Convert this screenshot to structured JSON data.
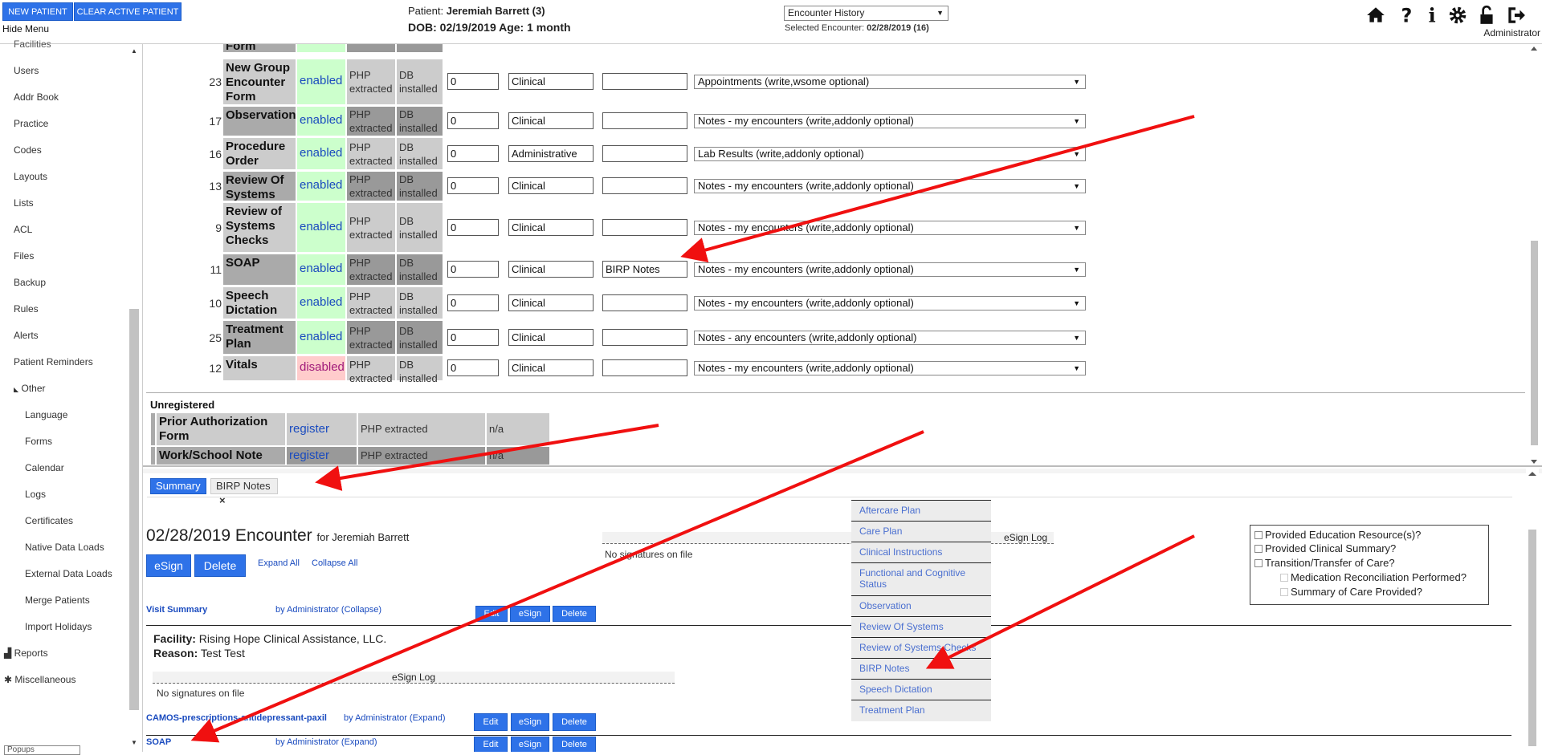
{
  "topbar": {
    "new_patient": "NEW PATIENT",
    "clear_patient": "CLEAR ACTIVE PATIENT",
    "hide_menu": "Hide Menu",
    "patient_label": "Patient:",
    "patient_name": "Jeremiah Barrett (3)",
    "dob_line": "DOB: 02/19/2019 Age: 1 month",
    "encounter_select": "Encounter History",
    "selected_label": "Selected Encounter:",
    "selected_value": "02/28/2019 (16)",
    "user": "Administrator"
  },
  "sidebar": {
    "top_partial": "Facilities",
    "items": [
      "Users",
      "Addr Book",
      "Practice",
      "Codes",
      "Layouts",
      "Lists",
      "ACL",
      "Files",
      "Backup",
      "Rules",
      "Alerts",
      "Patient Reminders"
    ],
    "other": "Other",
    "other_items": [
      "Language",
      "Forms",
      "Calendar",
      "Logs",
      "Certificates",
      "Native Data Loads",
      "External Data Loads",
      "Merge Patients",
      "Import Holidays"
    ],
    "reports": "Reports",
    "misc": "Miscellaneous",
    "bottom_select": "Popups"
  },
  "forms": {
    "partial_name": "Form",
    "rows": [
      {
        "id": "23",
        "name": [
          "New Group",
          "Encounter",
          "Form"
        ],
        "status": "enabled",
        "php": "PHP",
        "php2": "extracted",
        "db": "DB",
        "db2": "installed",
        "priority": "0",
        "category": "Clinical",
        "nickname": "",
        "acl": "Appointments (write,wsome optional)"
      },
      {
        "id": "17",
        "name": [
          "Observation"
        ],
        "status": "enabled",
        "php": "PHP",
        "php2": "extracted",
        "db": "DB",
        "db2": "installed",
        "priority": "0",
        "category": "Clinical",
        "nickname": "",
        "acl": "Notes - my encounters (write,addonly optional)"
      },
      {
        "id": "16",
        "name": [
          "Procedure",
          "Order"
        ],
        "status": "enabled",
        "php": "PHP",
        "php2": "extracted",
        "db": "DB",
        "db2": "installed",
        "priority": "0",
        "category": "Administrative",
        "nickname": "",
        "acl": "Lab Results (write,addonly optional)"
      },
      {
        "id": "13",
        "name": [
          "Review Of",
          "Systems"
        ],
        "status": "enabled",
        "php": "PHP",
        "php2": "extracted",
        "db": "DB",
        "db2": "installed",
        "priority": "0",
        "category": "Clinical",
        "nickname": "",
        "acl": "Notes - my encounters (write,addonly optional)"
      },
      {
        "id": "9",
        "name": [
          "Review of",
          "Systems",
          "Checks"
        ],
        "status": "enabled",
        "php": "PHP",
        "php2": "extracted",
        "db": "DB",
        "db2": "installed",
        "priority": "0",
        "category": "Clinical",
        "nickname": "",
        "acl": "Notes - my encounters (write,addonly optional)"
      },
      {
        "id": "11",
        "name": [
          "SOAP"
        ],
        "status": "enabled",
        "php": "PHP",
        "php2": "extracted",
        "db": "DB",
        "db2": "installed",
        "priority": "0",
        "category": "Clinical",
        "nickname": "BIRP Notes",
        "acl": "Notes - my encounters (write,addonly optional)"
      },
      {
        "id": "10",
        "name": [
          "Speech",
          "Dictation"
        ],
        "status": "enabled",
        "php": "PHP",
        "php2": "extracted",
        "db": "DB",
        "db2": "installed",
        "priority": "0",
        "category": "Clinical",
        "nickname": "",
        "acl": "Notes - my encounters (write,addonly optional)"
      },
      {
        "id": "25",
        "name": [
          "Treatment",
          "Plan"
        ],
        "status": "enabled",
        "php": "PHP",
        "php2": "extracted",
        "db": "DB",
        "db2": "installed",
        "priority": "0",
        "category": "Clinical",
        "nickname": "",
        "acl": "Notes - any encounters (write,addonly optional)"
      },
      {
        "id": "12",
        "name": [
          "Vitals"
        ],
        "status": "disabled",
        "php": "PHP",
        "php2": "extracted",
        "db": "DB",
        "db2": "installed",
        "priority": "0",
        "category": "Clinical",
        "nickname": "",
        "acl": "Notes - my encounters (write,addonly optional)"
      }
    ],
    "unregistered_title": "Unregistered",
    "unregistered": [
      {
        "name": [
          "Prior Authorization",
          "Form"
        ],
        "action": "register",
        "php": "PHP extracted",
        "na": "n/a"
      },
      {
        "name": [
          "Work/School Note"
        ],
        "action": "register",
        "php": "PHP extracted",
        "na": "n/a"
      }
    ]
  },
  "encounter": {
    "tabs": [
      "Summary",
      "BIRP Notes"
    ],
    "tab_close": "×",
    "title": "02/28/2019 Encounter",
    "for": "for Jeremiah Barrett",
    "esign": "eSign",
    "delete": "Delete",
    "expand_all": "Expand All",
    "collapse_all": "Collapse All",
    "esign_log": "eSign Log",
    "no_signatures": "No signatures on file",
    "visit_summary": "Visit Summary",
    "by_admin_collapse": "by Administrator (Collapse)",
    "edit": "Edit",
    "facility_label": "Facility:",
    "facility": "Rising Hope Clinical Assistance, LLC.",
    "reason_label": "Reason:",
    "reason": "Test Test",
    "camos": "CAMOS-prescriptions-antidepressant-paxil",
    "by_admin_expand": "by Administrator (Expand)",
    "soap": "SOAP"
  },
  "menu": {
    "items": [
      "Aftercare Plan",
      "Care Plan",
      "Clinical Instructions",
      "Functional and Cognitive Status",
      "Observation",
      "Review Of Systems",
      "Review of Systems Checks",
      "BIRP Notes",
      "Speech Dictation",
      "Treatment Plan"
    ]
  },
  "checks": {
    "items": [
      "Provided Education Resource(s)?",
      "Provided Clinical Summary?",
      "Transition/Transfer of Care?"
    ],
    "sub": [
      "Medication Reconciliation Performed?",
      "Summary of Care Provided?"
    ]
  },
  "colors": {
    "accent": "#2e72e8",
    "arrow": "#f01010",
    "enabled_bg": "#ccffcc",
    "disabled_bg": "#ffcccc"
  }
}
